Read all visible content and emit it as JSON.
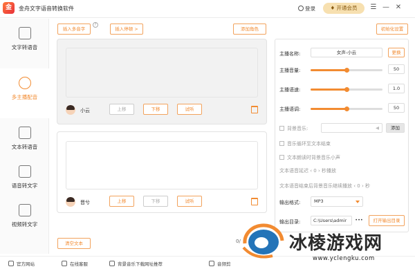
{
  "app": {
    "logo_char": "金",
    "title": "金舟文字语音转换软件"
  },
  "titlebar": {
    "login": "登录",
    "vip": "开通会员",
    "menu": "☰",
    "minimize": "—",
    "close": "✕"
  },
  "sidebar": {
    "items": [
      {
        "label": "文字转语音",
        "active": false
      },
      {
        "label": "多主播配音",
        "active": true
      },
      {
        "label": "文本转语音",
        "active": false
      },
      {
        "label": "语音转文字",
        "active": false
      },
      {
        "label": "视频转文字",
        "active": false
      }
    ]
  },
  "toolbar": {
    "insert_polyphone": "插入多音字",
    "hint": "?",
    "insert_pause": "插入停顿 >",
    "add_role": "添加角色",
    "init_settings": "初始化设置"
  },
  "voices": [
    {
      "name": "小云",
      "up": "上移",
      "down": "下移",
      "listen": "试听",
      "up_enabled": false,
      "down_enabled": true
    },
    {
      "name": "晋兮",
      "up": "上移",
      "down": "下移",
      "listen": "试听",
      "up_enabled": true,
      "down_enabled": false
    }
  ],
  "settings": {
    "anchor_label": "主播名称:",
    "anchor_value": "女声-小云",
    "change": "更换",
    "volume_label": "主播音量:",
    "volume_value": "50",
    "volume_level": 0.5,
    "speed_label": "主播语速:",
    "speed_value": "1.0",
    "speed_level": 0.5,
    "pitch_label": "主播语调:",
    "pitch_value": "50",
    "pitch_level": 0.5,
    "bgm_label": "背景音乐:",
    "bgm_add": "添加",
    "loop_label": "音乐循环至文本结束",
    "lower_label": "文本朗读时背景音乐小声",
    "delay_label": "文本语音延迟",
    "delay_value": "0",
    "delay_unit": "秒播放",
    "after_label": "文本语音结束后背景音乐继续播放",
    "after_value": "0",
    "after_unit": "秒",
    "format_label": "输出格式:",
    "format_value": "MP3",
    "dir_label": "输出目录:",
    "dir_value": "C:\\Users\\admir",
    "dir_more": "•••",
    "open_dir": "打开输出目录"
  },
  "bottom": {
    "clear_text": "清空文本",
    "counter": "0/"
  },
  "footer": {
    "items": [
      "官方网站",
      "在线客服",
      "背景音乐下载网址推荐",
      "音频剪"
    ]
  },
  "watermark": {
    "text": "冰棱游戏网",
    "url": "www.yclengku.com"
  },
  "colors": {
    "accent": "#f28b31",
    "vip_bg": "#f7e0b0",
    "logo": "#e8303a"
  }
}
